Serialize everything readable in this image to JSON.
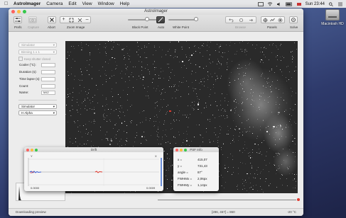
{
  "menubar": {
    "app": "AstroImager",
    "items": [
      "Camera",
      "Edit",
      "View",
      "Window",
      "Help"
    ],
    "clock": "Sun 23:44"
  },
  "desktop": {
    "hd_label": "Macintosh HD"
  },
  "window": {
    "title": "AstroImager",
    "toolbar": {
      "prefs": "Prefs",
      "capture": "Capture",
      "abort": "Abort",
      "zoom": "Zoom Image",
      "black_point": "Black Point",
      "auto": "Auto",
      "white_point": "White Point",
      "browse": "Browse",
      "panels": "Panels",
      "solve": "Solve"
    },
    "left": {
      "camera_select": "Simulator",
      "binning_select": "Binning 1 x 1",
      "keep_shutter": "Keep shutter closed",
      "cooler_label": "Cooler (°C):",
      "duration_label": "Duration (s):",
      "timelapse_label": "Time lapse (s):",
      "count_label": "Count:",
      "name_label": "Name:",
      "name_value": "M42",
      "filter_wheel_select": "Simulator",
      "filter_select": "H Alpha"
    },
    "status": {
      "left": "Downloading preview",
      "middle": "[286, 467] = 860",
      "right": "-20 °C"
    }
  },
  "drift": {
    "title": "Drift",
    "x_axis_label": "X",
    "y_axis_label": "Y",
    "left_value": "0.0000",
    "right_value": "0.0009"
  },
  "psf": {
    "title": "PSF Info",
    "rows": [
      {
        "label": "x =",
        "value": "415,07"
      },
      {
        "label": "y =",
        "value": "731,43"
      },
      {
        "label": "angle =",
        "value": "87°"
      },
      {
        "label": "FWHMx =",
        "value": "2,06px"
      },
      {
        "label": "FWHMy =",
        "value": "1,14px"
      }
    ]
  },
  "colors": {
    "accent_red": "#e03a2f",
    "drift_blue": "#3a5fd6"
  }
}
